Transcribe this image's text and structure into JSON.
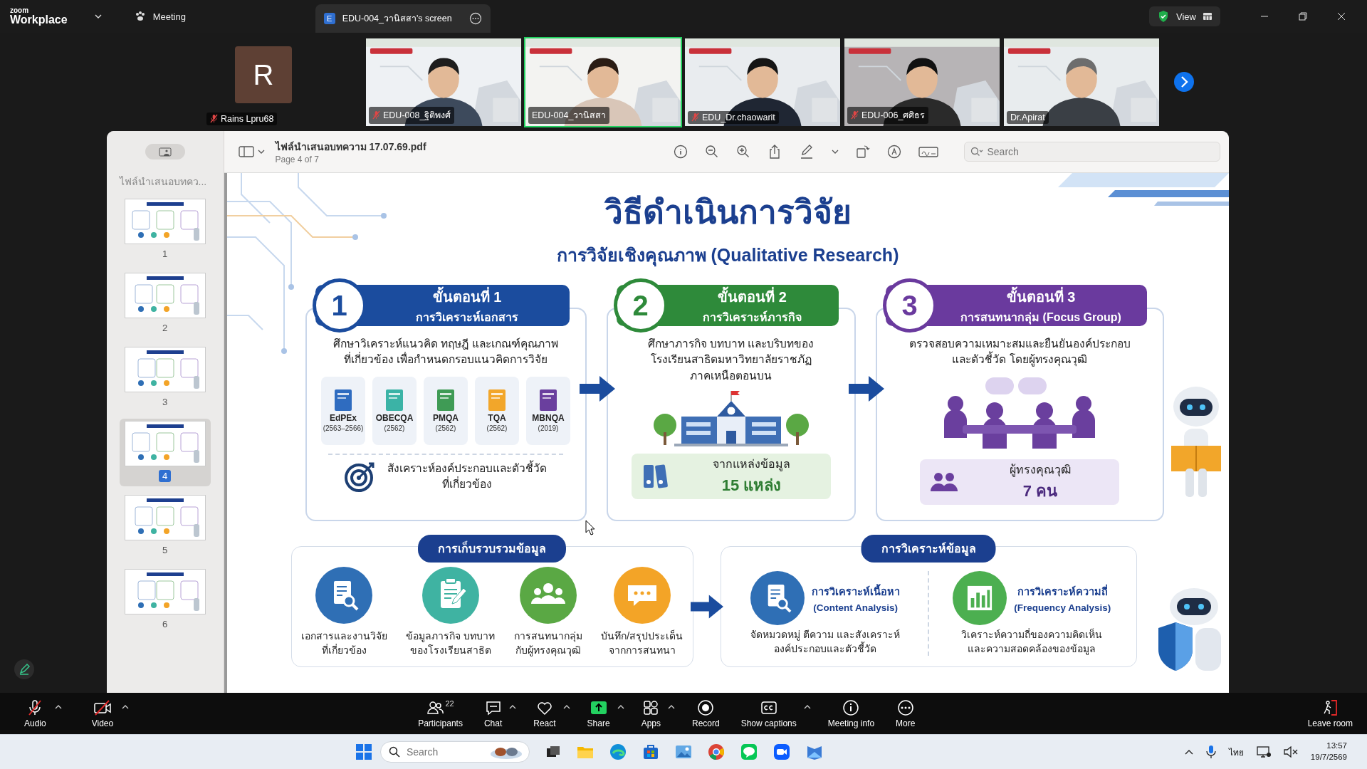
{
  "top_bar": {
    "brand_small": "zoom",
    "brand": "Workplace",
    "meeting_label": "Meeting",
    "share_tab": {
      "badge": "E",
      "title": "EDU-004_วานิสสา's screen"
    },
    "view_label": "View"
  },
  "participants_strip": {
    "avatar_tile": {
      "initial": "R",
      "name": "Rains Lpru68",
      "muted": true
    },
    "videos": [
      {
        "name": "EDU-008_ฐิติพงศ์",
        "muted": true,
        "active_speaker": false
      },
      {
        "name": "EDU-004_วานิสสา",
        "muted": false,
        "active_speaker": true
      },
      {
        "name": "EDU_Dr.chaowarit",
        "muted": true,
        "active_speaker": false
      },
      {
        "name": "EDU-006_ศศิธร",
        "muted": true,
        "active_speaker": false
      },
      {
        "name": "Dr.Apirat",
        "muted": false,
        "active_speaker": false
      }
    ]
  },
  "pdf_viewer": {
    "file_name": "ไฟล์นำเสนอบทความ 17.07.69.pdf",
    "page_info": "Page 4 of 7",
    "search_placeholder": "Search",
    "sidebar_title": "ไฟล์นำเสนอบทคว...",
    "thumbnails": [
      {
        "label": "1",
        "selected": false
      },
      {
        "label": "2",
        "selected": false
      },
      {
        "label": "3",
        "selected": false
      },
      {
        "label": "4",
        "selected": true
      },
      {
        "label": "5",
        "selected": false
      },
      {
        "label": "6",
        "selected": false
      }
    ]
  },
  "slide": {
    "title": "วิธีดำเนินการวิจัย",
    "subtitle": "การวิจัยเชิงคุณภาพ (Qualitative Research)",
    "steps": [
      {
        "kind": "documents",
        "number": "1",
        "heading": "ขั้นตอนที่ 1",
        "subheading": "การวิเคราะห์เอกสาร",
        "color": "#1b4c9e",
        "description": "ศึกษาวิเคราะห์แนวคิด ทฤษฎี และเกณฑ์คุณภาพ\nที่เกี่ยวข้อง เพื่อกำหนดกรอบแนวคิดการวิจัย",
        "standards": [
          {
            "name": "EdPEx",
            "years": "(2563–2566)",
            "color": "#2f6cc0"
          },
          {
            "name": "OBECQA",
            "years": "(2562)",
            "color": "#3bb3a6"
          },
          {
            "name": "PMQA",
            "years": "(2562)",
            "color": "#3f9b55"
          },
          {
            "name": "TQA",
            "years": "(2562)",
            "color": "#f2a62a"
          },
          {
            "name": "MBNQA",
            "years": "(2019)",
            "color": "#6a3f9e"
          }
        ],
        "footer": "สังเคราะห์องค์ประกอบและตัวชี้วัด\nที่เกี่ยวข้อง"
      },
      {
        "kind": "sources",
        "number": "2",
        "heading": "ขั้นตอนที่ 2",
        "subheading": "การวิเคราะห์ภารกิจ",
        "color": "#2e8a3a",
        "description": "ศึกษาภารกิจ บทบาท และบริบทของ\nโรงเรียนสาธิตมหาวิทยาลัยราชภัฏ\nภาคเหนือตอนบน",
        "box_label": "จากแหล่งข้อมูล",
        "box_value": "15 แหล่ง"
      },
      {
        "kind": "experts",
        "number": "3",
        "heading": "ขั้นตอนที่ 3",
        "subheading": "การสนทนากลุ่ม (Focus Group)",
        "color": "#6a3a9e",
        "description": "ตรวจสอบความเหมาะสมและยืนยันองค์ประกอบ\nและตัวชี้วัด โดยผู้ทรงคุณวุฒิ",
        "box_label": "ผู้ทรงคุณวุฒิ",
        "box_value": "7 คน"
      }
    ],
    "collection": {
      "title": "การเก็บรวบรวมข้อมูล",
      "items": [
        {
          "kind": "document",
          "label": "เอกสารและงานวิจัย\nที่เกี่ยวข้อง",
          "color": "#2f6fb5"
        },
        {
          "kind": "clipboard",
          "label": "ข้อมูลภารกิจ บทบาท\nของโรงเรียนสาธิต",
          "color": "#3fb3a2"
        },
        {
          "kind": "group",
          "label": "การสนทนากลุ่ม\nกับผู้ทรงคุณวุฒิ",
          "color": "#5aa844"
        },
        {
          "kind": "chat",
          "label": "บันทึก/สรุปประเด็น\nจากการสนทนา",
          "color": "#f3a427"
        }
      ]
    },
    "analysis": {
      "title": "การวิเคราะห์ข้อมูล",
      "items": [
        {
          "kind": "document",
          "title": "การวิเคราะห์เนื้อหา",
          "subtitle": "(Content Analysis)",
          "description": "จัดหมวดหมู่ ตีความ และสังเคราะห์\nองค์ประกอบและตัวชี้วัด",
          "color": "#2f6fb5"
        },
        {
          "kind": "chart",
          "title": "การวิเคราะห์ความถี่",
          "subtitle": "(Frequency Analysis)",
          "description": "วิเคราะห์ความถี่ของความคิดเห็น\nและความสอดคล้องของข้อมูล",
          "color": "#4caf50"
        }
      ]
    }
  },
  "meeting_toolbar": {
    "audio": {
      "label": "Audio",
      "muted": true
    },
    "video": {
      "label": "Video",
      "off": true
    },
    "items": [
      {
        "kind": "participants",
        "label": "Participants",
        "count": "22",
        "caret": false
      },
      {
        "kind": "chat",
        "label": "Chat",
        "caret": true
      },
      {
        "kind": "react",
        "label": "React",
        "caret": true
      },
      {
        "kind": "share",
        "label": "Share",
        "caret": true
      },
      {
        "kind": "apps",
        "label": "Apps",
        "caret": true
      },
      {
        "kind": "record",
        "label": "Record",
        "caret": false
      },
      {
        "kind": "captions",
        "label": "Show captions",
        "caret": true
      },
      {
        "kind": "info",
        "label": "Meeting info",
        "caret": false
      },
      {
        "kind": "more",
        "label": "More",
        "caret": false
      }
    ],
    "leave_label": "Leave room"
  },
  "taskbar": {
    "search_placeholder": "Search",
    "language": "ไทย",
    "time": "13:57",
    "date": "19/7/2569"
  }
}
